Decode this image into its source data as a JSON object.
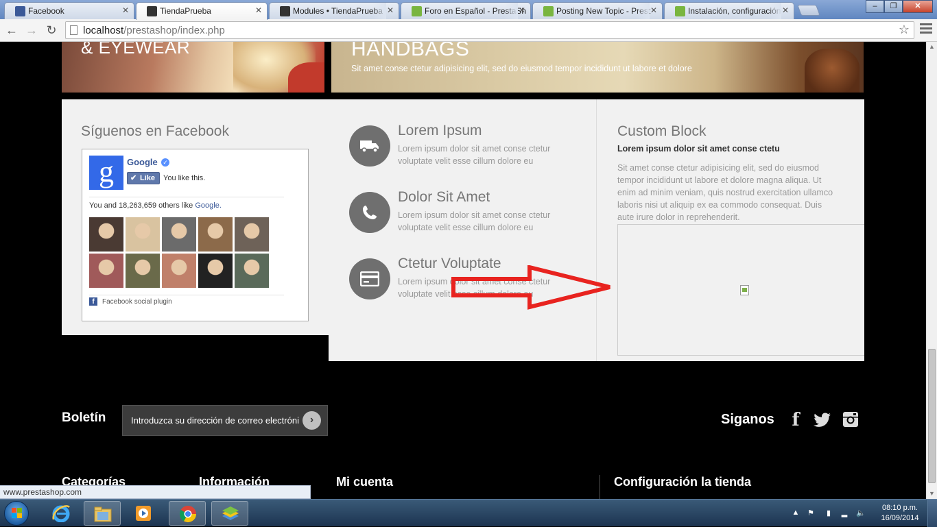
{
  "browser": {
    "tabs": [
      {
        "title": "Facebook",
        "favicon_color": "#3b5998"
      },
      {
        "title": "TiendaPrueba",
        "favicon_color": "#333333"
      },
      {
        "title": "Modules • TiendaPrueba",
        "favicon_color": "#333333"
      },
      {
        "title": "Foro en Español - PrestaSh",
        "favicon_color": "#79b53f"
      },
      {
        "title": "Posting New Topic - Prest",
        "favicon_color": "#79b53f"
      },
      {
        "title": "Instalación, configuración",
        "favicon_color": "#79b53f"
      }
    ],
    "url_host": "localhost",
    "url_path": "/prestashop/index.php",
    "status_url": "www.prestashop.com"
  },
  "banners": {
    "left_title": "& EYEWEAR",
    "right_title": "HANDBAGS",
    "right_subtitle": "Sit amet conse ctetur adipisicing elit, sed do eiusmod tempor incididunt ut labore et dolore"
  },
  "facebook_block": {
    "heading": "Síguenos en Facebook",
    "page_name": "Google",
    "like_label": "Like",
    "you_like": "You like this.",
    "count_prefix": "You and 18,263,659 others like",
    "count_link": "Google.",
    "plugin_label": "Facebook social plugin",
    "face_colors": [
      "#4a3a33",
      "#d9c3a0",
      "#6b6b6b",
      "#8c6a4a",
      "#6e6258",
      "#a05a5a",
      "#6a6a4a",
      "#c0806a",
      "#222222",
      "#5a6a5a"
    ]
  },
  "info_block": {
    "items": [
      {
        "title": "Lorem Ipsum",
        "text": "Lorem ipsum dolor sit amet conse ctetur voluptate velit esse cillum dolore eu",
        "icon": "truck-icon"
      },
      {
        "title": "Dolor Sit Amet",
        "text": "Lorem ipsum dolor sit amet conse ctetur voluptate velit esse cillum dolore eu",
        "icon": "phone-icon"
      },
      {
        "title": "Ctetur Voluptate",
        "text": "Lorem ipsum dolor sit amet conse ctetur voluptate velit esse cillum dolore eu",
        "icon": "credit-card-icon"
      }
    ]
  },
  "custom_block": {
    "heading": "Custom Block",
    "bold": "Lorem ipsum dolor sit amet conse ctetu",
    "paragraph": "Sit amet conse ctetur adipisicing elit, sed do eiusmod tempor incididunt ut labore et dolore magna aliqua. Ut enim ad minim veniam, quis nostrud exercitation ullamco laboris nisi ut aliquip ex ea commodo consequat. Duis aute irure dolor in reprehenderit."
  },
  "newsletter": {
    "label": "Boletín",
    "placeholder": "Introduzca su dirección de correo electrónico"
  },
  "social": {
    "label": "Siganos"
  },
  "footer": {
    "columns": [
      "Categorías",
      "Información",
      "Mi cuenta",
      "Configuración la tienda"
    ]
  },
  "taskbar": {
    "time": "08:10 p.m.",
    "date": "16/09/2014"
  },
  "colors": {
    "arrow": "#e8231f",
    "info_circle": "#6f6f6f"
  }
}
